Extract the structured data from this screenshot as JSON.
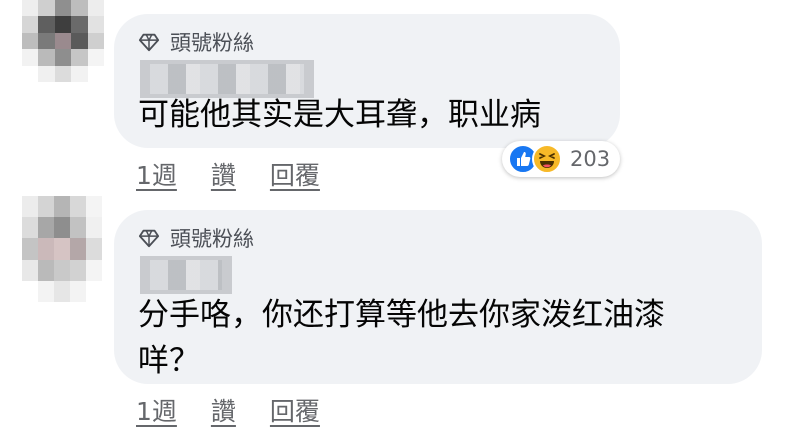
{
  "comments": [
    {
      "badge": "頭號粉絲",
      "text": "可能他其实是大耳聋，职业病",
      "actions": {
        "time": "1週",
        "like": "讚",
        "reply": "回覆"
      },
      "reactions": {
        "types": [
          "like-icon",
          "haha-icon"
        ],
        "count": "203"
      }
    },
    {
      "badge": "頭號粉絲",
      "text_line1": "分手咯，你还打算等他去你家泼红油漆",
      "text_line2": "咩？",
      "actions": {
        "time": "1週",
        "like": "讚",
        "reply": "回覆"
      }
    }
  ],
  "colors": {
    "bubble": "#f0f2f5",
    "like_blue": "#1877f2",
    "haha_yellow": "#f7b928",
    "meta_text": "#65676b"
  }
}
